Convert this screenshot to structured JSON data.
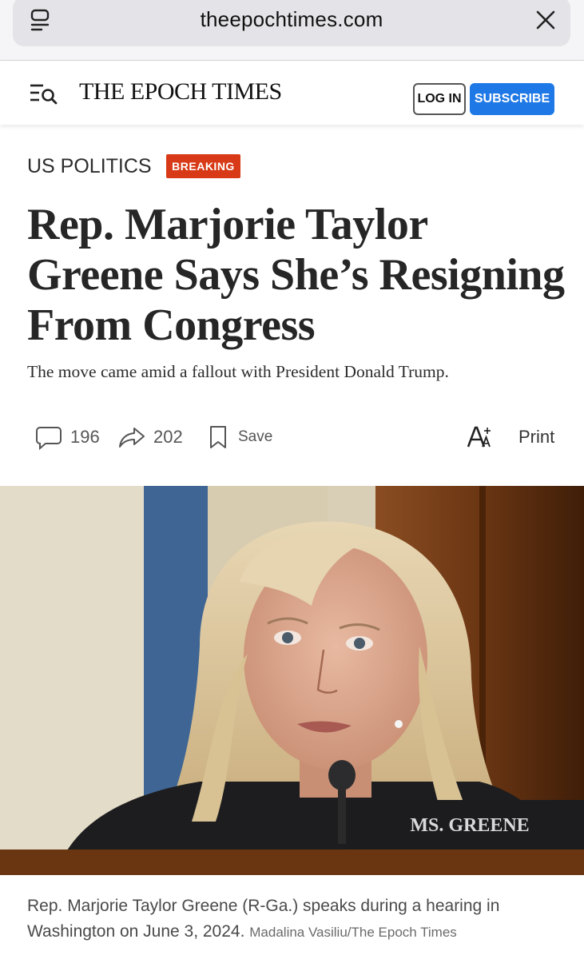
{
  "browser": {
    "url": "theepochtimes.com",
    "reader_icon": "reader-mode-icon",
    "close_icon": "close-icon"
  },
  "header": {
    "menu_icon": "menu-search-icon",
    "logo": "THE EPOCH TIMES",
    "login_label": "LOG IN",
    "subscribe_label": "SUBSCRIBE",
    "subscribe_color": "#1e78e6"
  },
  "article": {
    "section": "US POLITICS",
    "badge": "BREAKING",
    "badge_color": "#d83a17",
    "headline": "Rep. Marjorie Taylor Greene Says She’s Resigning From Congress",
    "subheadline": "The move came amid a fallout with President Donald Trump.",
    "actions": {
      "comments_count": "196",
      "shares_count": "202",
      "save_label": "Save",
      "print_label": "Print",
      "icons": [
        "comment-icon",
        "share-icon",
        "bookmark-icon",
        "font-size-icon"
      ]
    },
    "photo": {
      "nameplate": "MS. GREENE",
      "caption": "Rep. Marjorie Taylor Greene (R-Ga.) speaks during a hearing in Washington on June 3, 2024.",
      "credit": "Madalina Vasiliu/The Epoch Times"
    }
  }
}
